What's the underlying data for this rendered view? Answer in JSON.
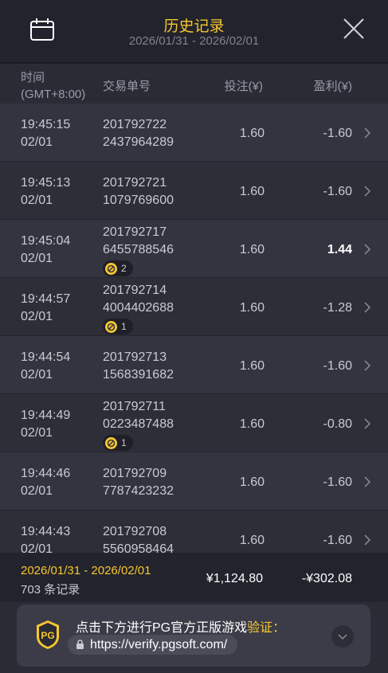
{
  "header": {
    "title": "历史记录",
    "date_range": "2026/01/31 - 2026/02/01"
  },
  "columns": {
    "time_line1": "时间",
    "time_line2": "(GMT+8:00)",
    "tx_id": "交易单号",
    "bet": "投注(¥)",
    "profit": "盈利(¥)"
  },
  "rows": [
    {
      "time": "19:45:15",
      "date": "02/01",
      "id_a": "201792722",
      "id_b": "2437964289",
      "badge": "",
      "bet": "1.60",
      "profit": "-1.60"
    },
    {
      "time": "19:45:13",
      "date": "02/01",
      "id_a": "201792721",
      "id_b": "1079769600",
      "badge": "",
      "bet": "1.60",
      "profit": "-1.60"
    },
    {
      "time": "19:45:04",
      "date": "02/01",
      "id_a": "201792717",
      "id_b": "6455788546",
      "badge": "2",
      "bet": "1.60",
      "profit": "1.44"
    },
    {
      "time": "19:44:57",
      "date": "02/01",
      "id_a": "201792714",
      "id_b": "4004402688",
      "badge": "1",
      "bet": "1.60",
      "profit": "-1.28"
    },
    {
      "time": "19:44:54",
      "date": "02/01",
      "id_a": "201792713",
      "id_b": "1568391682",
      "badge": "",
      "bet": "1.60",
      "profit": "-1.60"
    },
    {
      "time": "19:44:49",
      "date": "02/01",
      "id_a": "201792711",
      "id_b": "0223487488",
      "badge": "1",
      "bet": "1.60",
      "profit": "-0.80"
    },
    {
      "time": "19:44:46",
      "date": "02/01",
      "id_a": "201792709",
      "id_b": "7787423232",
      "badge": "",
      "bet": "1.60",
      "profit": "-1.60"
    },
    {
      "time": "19:44:43",
      "date": "02/01",
      "id_a": "201792708",
      "id_b": "5560958464",
      "badge": "",
      "bet": "1.60",
      "profit": "-1.60"
    }
  ],
  "summary": {
    "date_range": "2026/01/31 - 2026/02/01",
    "record_count": "703 条记录",
    "total_bet": "¥1,124.80",
    "total_profit": "-¥302.08"
  },
  "verify": {
    "text": "点击下方进行PG官方正版游戏",
    "highlight": "验证：",
    "url": "https://verify.pgsoft.com/",
    "logo_text": "PG"
  },
  "icons": {
    "calendar": "calendar-icon",
    "close": "close-icon",
    "chevron": "chevron-right-icon",
    "coin": "free-spin-coin-icon",
    "lock": "lock-icon",
    "expand": "chevron-down-icon"
  },
  "colors": {
    "accent": "#f7c730",
    "header_bg": "#22232c",
    "row_odd": "#33343f",
    "row_even": "#2d2e38"
  }
}
